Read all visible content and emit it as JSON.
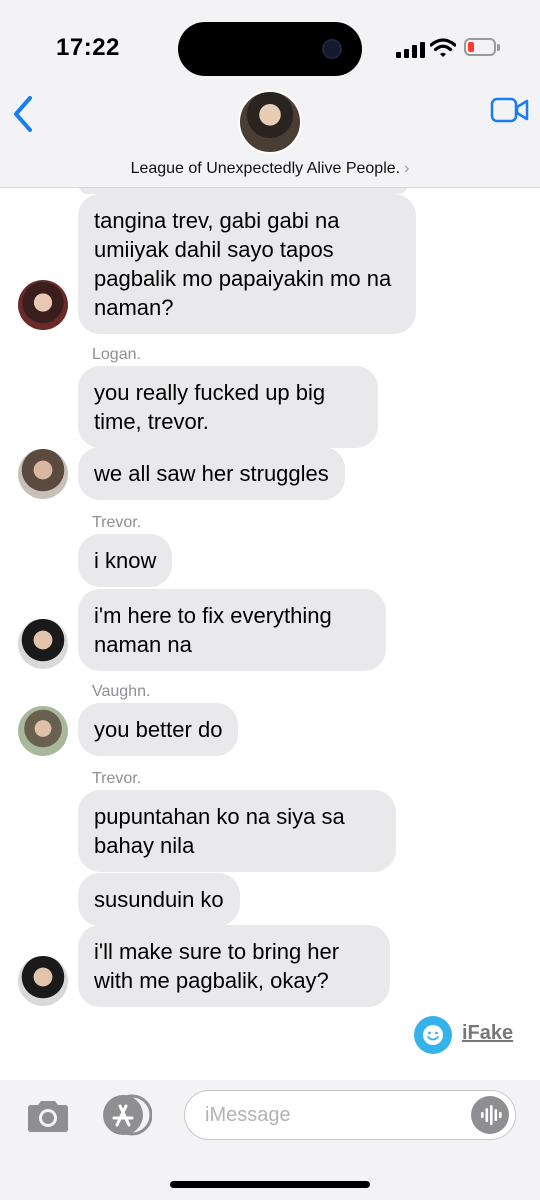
{
  "status": {
    "time": "17:22"
  },
  "header": {
    "group_name": "League of Unexpectedly Alive People.",
    "chevron": "›"
  },
  "messages": [
    {
      "text": "tangina trev, gabi gabi na umiiyak dahil sayo tapos pagbalik mo papaiyakin mo na naman?"
    },
    {
      "sender": "Logan."
    },
    {
      "text": "you really fucked up big time, trevor."
    },
    {
      "text": "we all saw her struggles"
    },
    {
      "sender": "Trevor."
    },
    {
      "text": "i know"
    },
    {
      "text": "i'm here to fix everything naman na"
    },
    {
      "sender": "Vaughn."
    },
    {
      "text": "you better do"
    },
    {
      "sender": "Trevor."
    },
    {
      "text": "pupuntahan ko na siya sa bahay nila"
    },
    {
      "text": "susunduin ko"
    },
    {
      "text": "i'll make sure to bring her with me pagbalik, okay?"
    }
  ],
  "watermark": {
    "text": "iFake"
  },
  "composer": {
    "placeholder": "iMessage"
  },
  "colors": {
    "accent": "#1a7cf5",
    "bubble": "#e9e9eb",
    "watermark": "#35b2ec"
  },
  "icons": [
    "back-chevron-icon",
    "video-camera-icon",
    "camera-icon",
    "app-store-icon",
    "audio-waveform-icon"
  ]
}
